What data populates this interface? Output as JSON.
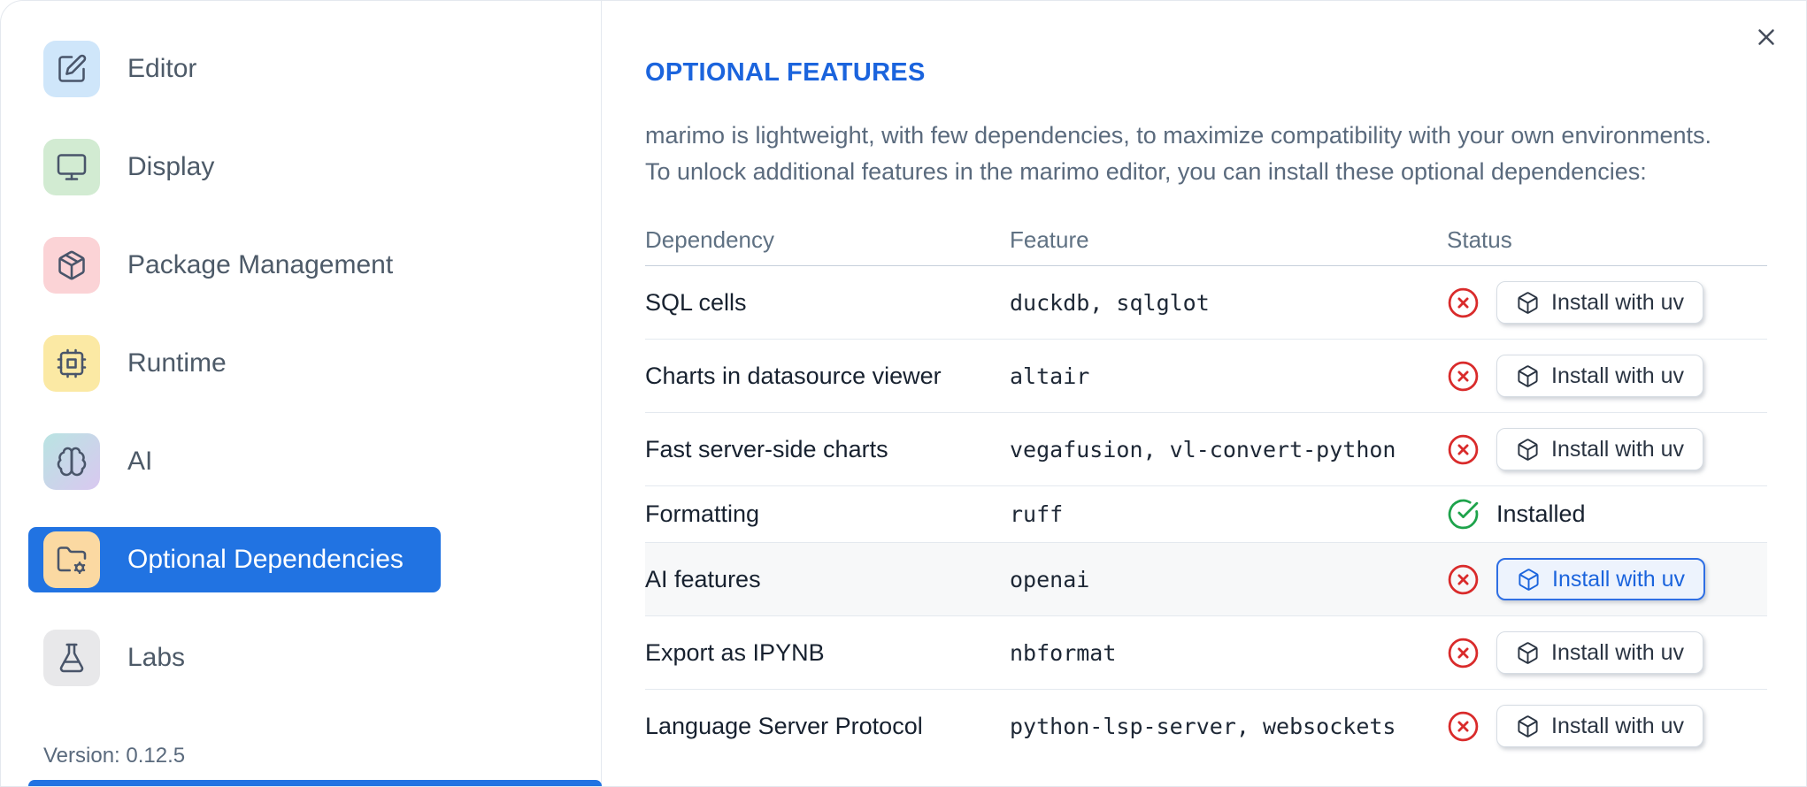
{
  "sidebar": {
    "items": [
      {
        "label": "Editor",
        "icon": "edit-icon",
        "tile_bg": "#cfe6fa",
        "selected": false
      },
      {
        "label": "Display",
        "icon": "monitor-icon",
        "tile_bg": "#d2ebd2",
        "selected": false
      },
      {
        "label": "Package Management",
        "icon": "package-icon",
        "tile_bg": "#fbd3d6",
        "selected": false
      },
      {
        "label": "Runtime",
        "icon": "cpu-icon",
        "tile_bg": "#fbe9a4",
        "selected": false
      },
      {
        "label": "AI",
        "icon": "brain-icon",
        "tile_bg": "linear-gradient(135deg,#b9e4e2,#d9c8f0)",
        "selected": false
      },
      {
        "label": "Optional Dependencies",
        "icon": "folder-cog-icon",
        "tile_bg": "#fbd9a2",
        "selected": true
      },
      {
        "label": "Labs",
        "icon": "flask-icon",
        "tile_bg": "#e8e8ea",
        "selected": false
      }
    ],
    "version": "Version: 0.12.5"
  },
  "main": {
    "title": "OPTIONAL FEATURES",
    "description": "marimo is lightweight, with few dependencies, to maximize compatibility with your own environments.\nTo unlock additional features in the marimo editor, you can install these optional dependencies:",
    "table": {
      "columns": [
        "Dependency",
        "Feature",
        "Status"
      ],
      "install_button_label": "Install with uv",
      "installed_label": "Installed",
      "rows": [
        {
          "dependency": "SQL cells",
          "feature": "duckdb, sqlglot",
          "status": "missing",
          "highlighted": false
        },
        {
          "dependency": "Charts in datasource viewer",
          "feature": "altair",
          "status": "missing",
          "highlighted": false
        },
        {
          "dependency": "Fast server-side charts",
          "feature": "vegafusion, vl-convert-python",
          "status": "missing",
          "highlighted": false
        },
        {
          "dependency": "Formatting",
          "feature": "ruff",
          "status": "installed",
          "highlighted": false
        },
        {
          "dependency": "AI features",
          "feature": "openai",
          "status": "missing",
          "highlighted": true
        },
        {
          "dependency": "Export as IPYNB",
          "feature": "nbformat",
          "status": "missing",
          "highlighted": false
        },
        {
          "dependency": "Language Server Protocol",
          "feature": "python-lsp-server, websockets",
          "status": "missing",
          "highlighted": false
        }
      ]
    }
  },
  "colors": {
    "accent_blue": "#2173e2",
    "title_blue": "#1b64dd",
    "status_missing_red": "#d92b2b",
    "status_installed_green": "#1ea34b"
  }
}
